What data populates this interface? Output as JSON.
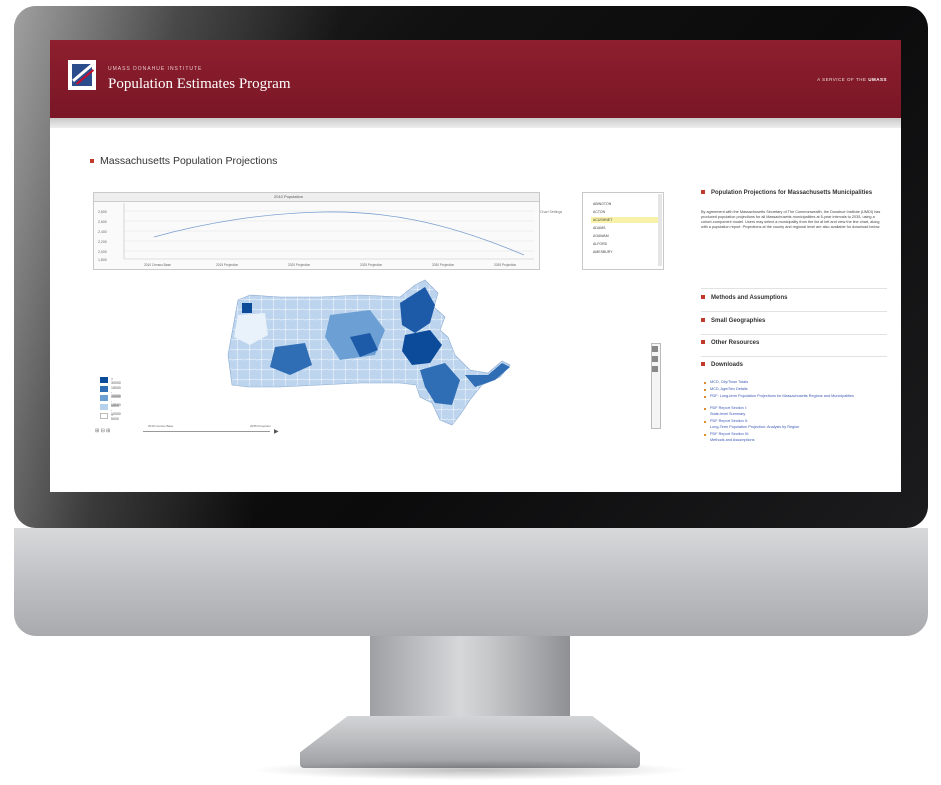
{
  "header": {
    "institute": "UMASS DONAHUE INSTITUTE",
    "program": "Population Estimates Program",
    "service_prefix": "A SERVICE OF THE",
    "service_org": "UMASS"
  },
  "page_title": "Massachusetts Population Projections",
  "chart": {
    "title": "2010 Population",
    "y_ticks": [
      "2,800",
      "2,600",
      "2,400",
      "2,200",
      "2,000",
      "1,800"
    ],
    "x_ticks": [
      "2010 Census Base",
      "2015 Projection",
      "2020 Projection",
      "2025 Projection",
      "2030 Projection",
      "2035 Projection"
    ],
    "side_label": "Chart Settings"
  },
  "municipalities": {
    "items": [
      "ABINGTON",
      "ACTON",
      "ACUSHNET",
      "ADAMS",
      "AGAWAM",
      "ALFORD",
      "AMESBURY"
    ],
    "selected": "ACUSHNET"
  },
  "legend": {
    "items": [
      "> 30000",
      "15000 - 30000",
      "10000 - 15000",
      "5000 - 10000",
      "< 5000"
    ],
    "colors": [
      "#0b4b9a",
      "#2f6db5",
      "#6c9fd3",
      "#b7d1ec",
      "#ffffff"
    ]
  },
  "map_controls": {
    "zoom_label": "⊞ ⊟ ⊞",
    "timeline_start": "2010 Census Base",
    "timeline_end": "2035 Projection",
    "play": "▶"
  },
  "right_panel": {
    "intro_heading": "Population Projections for Massachusetts Municipalities",
    "intro_text": "By agreement with the Massachusetts Secretary of The Commonwealth, the Donahue Institute (UMDI) has produced population projections for all Massachusetts municipalities at 5-year intervals to 2035, using a cohort-component model. Users may select a municipality from the list at left and view the line chart, along with a population report. Projections at the county and regional level are also available for download below.",
    "sections": [
      "Methods and Assumptions",
      "Small Geographies",
      "Other Resources",
      "Downloads"
    ],
    "downloads": [
      "MCD, City/Town Totals",
      "MCD, Age/Sex Details",
      "PDF: Long-term Population Projections for Massachusetts Regions and Municipalities",
      "PDF Report Section I:",
      "State-level Summary",
      "PDF Report Section II:",
      "Long-Term Population Projection: Analysis by Region",
      "PDF Report Section III:",
      "Methods and Assumptions"
    ]
  },
  "colors": {
    "brand": "#8d1f2e",
    "map_dark": "#0b4b9a",
    "map_mid": "#6c9fd3",
    "link": "#3b57b5"
  }
}
